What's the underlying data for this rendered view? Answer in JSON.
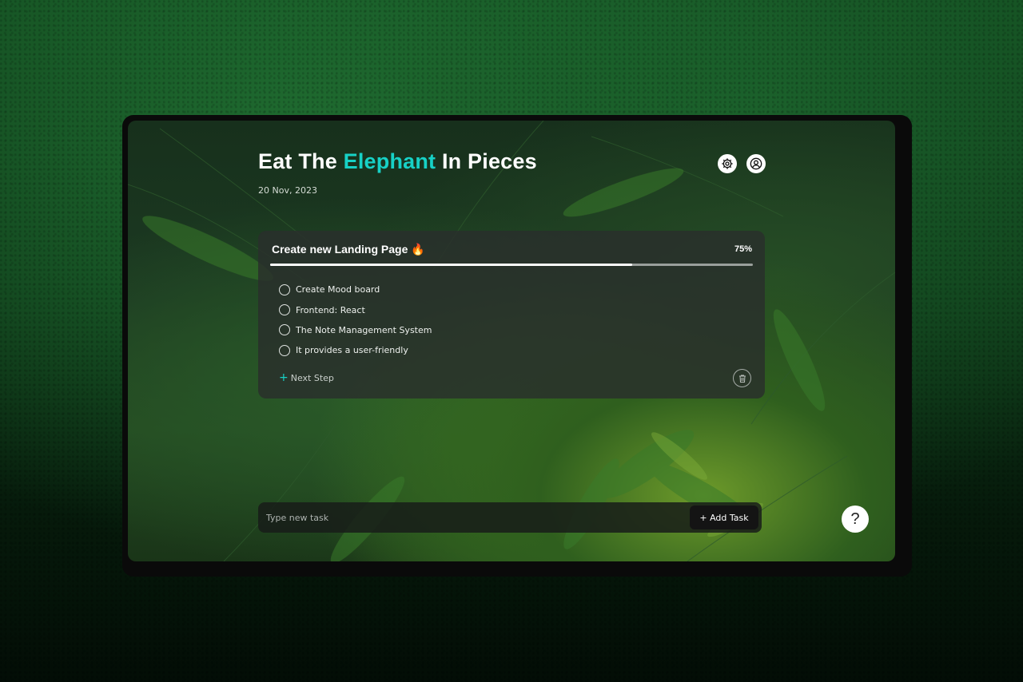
{
  "app": {
    "title_part1": "Eat The ",
    "title_accent": "Elephant",
    "title_part2": " In Pieces",
    "date": "20 Nov, 2023"
  },
  "header_icons": [
    "gear-icon",
    "user-circle-icon"
  ],
  "task_card": {
    "title": "Create new Landing Page 🔥",
    "progress_label": "75%",
    "progress_fraction": 0.75,
    "steps": [
      {
        "label": "Create Mood board",
        "checked": false
      },
      {
        "label": "Frontend: React",
        "checked": false
      },
      {
        "label": "The Note Management System",
        "checked": false
      },
      {
        "label": "It provides a user-friendly",
        "checked": false
      }
    ],
    "next_step_label": "Next Step",
    "delete_icon": "trash-icon"
  },
  "new_task": {
    "placeholder": "Type new task",
    "value": "",
    "add_label": "+ Add Task"
  },
  "help": {
    "label": "?"
  },
  "colors": {
    "accent": "#17d1c6",
    "card_bg": "#2a2e2c",
    "button_bg": "#141414"
  }
}
